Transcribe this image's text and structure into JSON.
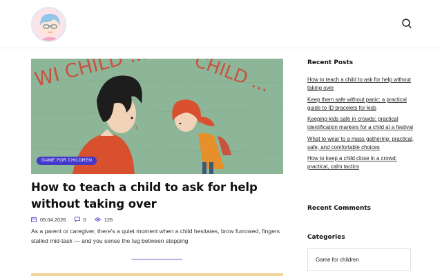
{
  "header": {
    "logo_icon": "child-face-logo-icon",
    "search_icon": "search-icon"
  },
  "post": {
    "image_caption_text": "WI  CHILD ...",
    "category": "GAME FOR CHILDREN",
    "title": "How to teach a child to ask for help without taking over",
    "date": "09.04.2026",
    "comments": "0",
    "views": "126",
    "excerpt": "As a parent or caregiver, there’s a quiet moment when a child hesitates, brow furrowed, fingers stalled mid-task — and you sense the tug between stepping"
  },
  "sidebar": {
    "recent_posts_title": "Recent Posts",
    "recent_posts": [
      {
        "label": "How to teach a child to ask for help without taking over"
      },
      {
        "label": "Keep them safe without panic: a practical guide to ID bracelets for kids"
      },
      {
        "label": "Keeping kids safe in crowds: practical identification markers for a child at a festival"
      },
      {
        "label": "What to wear to a mass gathering: practical, safe, and comfortable choices"
      },
      {
        "label": "How to keep a child close in a crowd: practical, calm tactics"
      }
    ],
    "recent_comments_title": "Recent Comments",
    "categories_title": "Categories",
    "categories": [
      {
        "label": "Game for children"
      }
    ]
  },
  "colors": {
    "accent": "#4338ca",
    "image_bg": "#8db598",
    "heading": "#111111"
  }
}
